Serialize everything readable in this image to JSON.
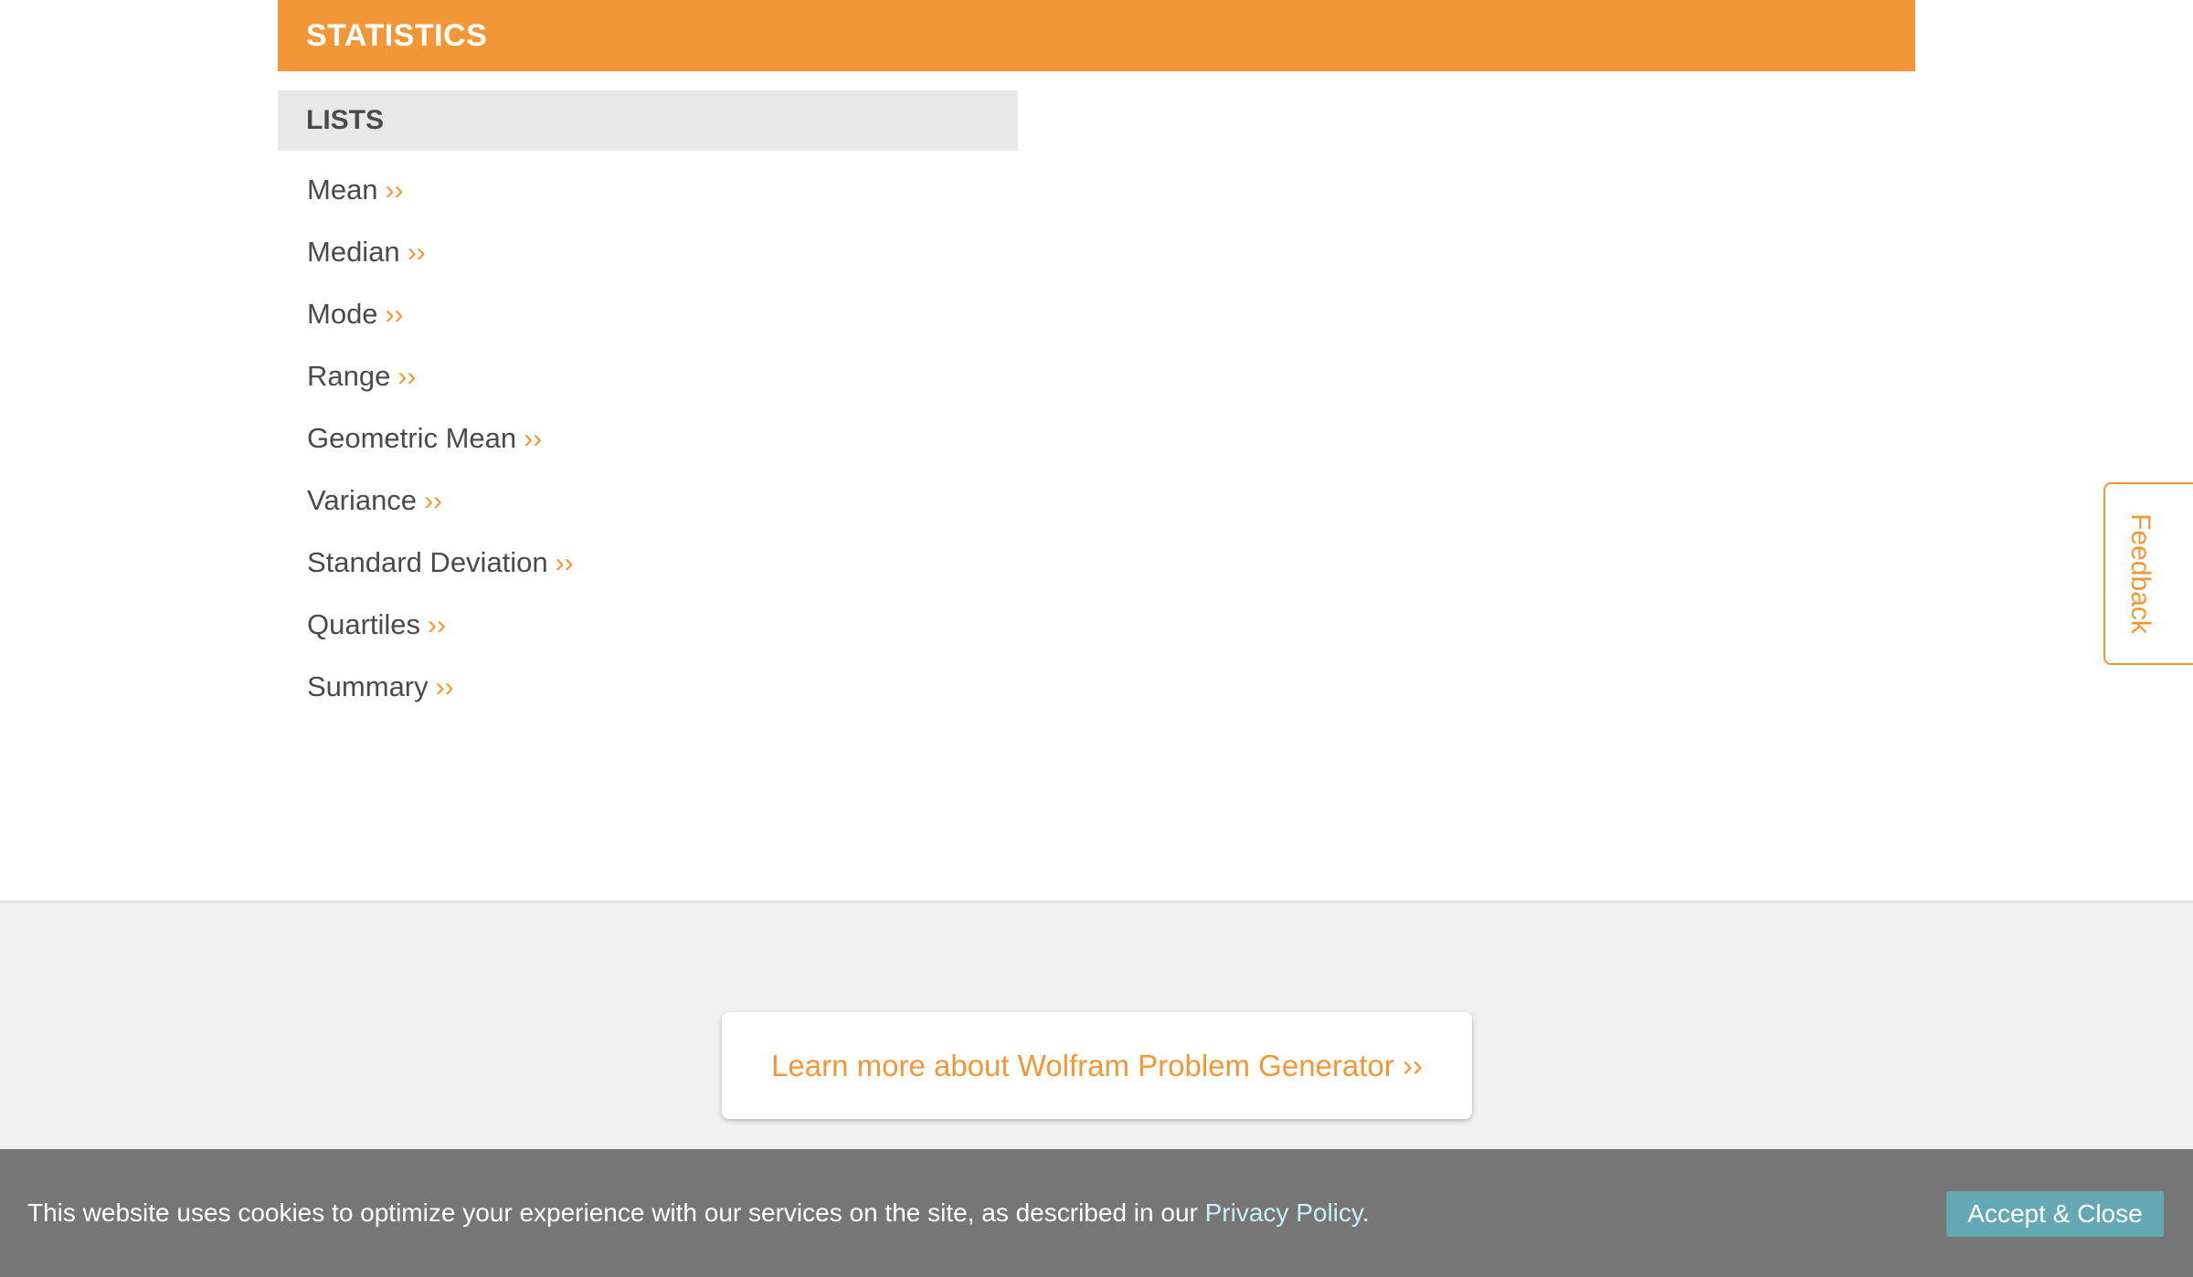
{
  "section": {
    "title": "STATISTICS"
  },
  "subsection": {
    "title": "LISTS"
  },
  "topics": [
    {
      "label": "Mean",
      "chevron": "››"
    },
    {
      "label": "Median",
      "chevron": "››"
    },
    {
      "label": "Mode",
      "chevron": "››"
    },
    {
      "label": "Range",
      "chevron": "››"
    },
    {
      "label": "Geometric Mean",
      "chevron": "››"
    },
    {
      "label": "Variance",
      "chevron": "››"
    },
    {
      "label": "Standard Deviation",
      "chevron": "››"
    },
    {
      "label": "Quartiles",
      "chevron": "››"
    },
    {
      "label": "Summary",
      "chevron": "››"
    }
  ],
  "feedback": {
    "label": "Feedback"
  },
  "promo": {
    "label": "Learn more about Wolfram Problem Generator ››"
  },
  "cookie": {
    "text": "This website uses cookies to optimize your experience with our services on the site, as described in our ",
    "link_label": "Privacy Policy",
    "suffix": ".",
    "accept_label": "Accept & Close"
  },
  "colors": {
    "accent": "#f29737",
    "subheader_bg": "#e8e8e8",
    "footer_bg": "#f1f1f1",
    "cookie_bg": "#767676",
    "accept_bg": "#63a8b3"
  }
}
